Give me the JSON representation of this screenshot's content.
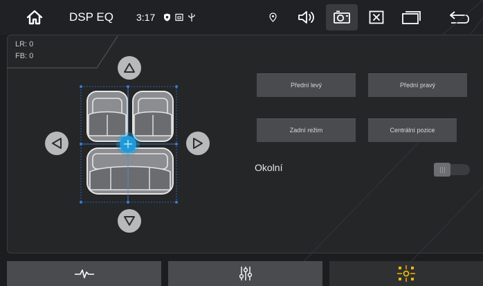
{
  "statusbar": {
    "title": "DSP EQ",
    "time": "3:17"
  },
  "coords": {
    "lr": "LR: 0",
    "fb": "FB: 0"
  },
  "presets": {
    "front_left": "Přední levý",
    "front_right": "Přední pravý",
    "rear_mode": "Zadní režim",
    "center": "Centrální pozice"
  },
  "surround": {
    "label": "Okolní",
    "enabled": false
  },
  "colors": {
    "accent": "#f2b705",
    "focus": "#1fa0e0"
  },
  "icons": {
    "home": "home-icon",
    "shield": "shield-icon",
    "sd": "sd-card-icon",
    "usb": "usb-icon",
    "location": "location-icon",
    "volume": "volume-icon",
    "screenshot": "camera-icon",
    "close": "close-window-icon",
    "windows": "recent-apps-icon",
    "back": "back-icon",
    "tab_eq": "waveform-icon",
    "tab_sliders": "sliders-icon",
    "tab_sound_field": "sound-field-icon"
  }
}
